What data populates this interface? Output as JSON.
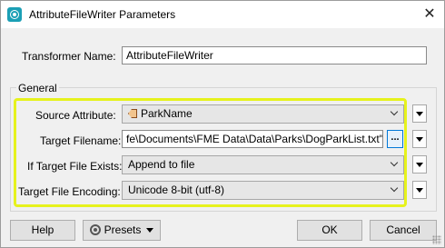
{
  "window": {
    "title": "AttributeFileWriter Parameters",
    "close_symbol": "✕",
    "app_icon": "fme-app-icon"
  },
  "transformer": {
    "label": "Transformer Name:",
    "value": "AttributeFileWriter"
  },
  "general": {
    "group_title": "General",
    "source_attribute": {
      "label": "Source Attribute:",
      "value": "ParkName",
      "icon": "attribute-icon"
    },
    "target_filename": {
      "label": "Target Filename:",
      "value": "fe\\Documents\\FME Data\\Data\\Parks\\DogParkList.txt\"",
      "browse_label": "..."
    },
    "if_exists": {
      "label": "If Target File Exists:",
      "value": "Append to file"
    },
    "encoding": {
      "label": "Target File Encoding:",
      "value": "Unicode 8-bit (utf-8)"
    }
  },
  "footer": {
    "help_label": "Help",
    "presets_label": "Presets",
    "ok_label": "OK",
    "cancel_label": "Cancel"
  },
  "colors": {
    "highlight": "#e6f21c",
    "focus_blue": "#0078d7"
  }
}
